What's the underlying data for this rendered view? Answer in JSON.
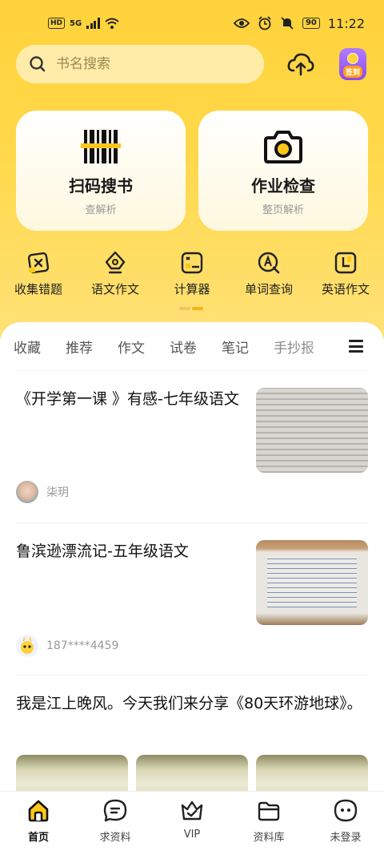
{
  "status_bar": {
    "network_badge": "HD",
    "network_type": "5G",
    "battery": "90",
    "time": "11:22"
  },
  "search": {
    "placeholder": "书名搜索"
  },
  "header_icons": {
    "upload": "upload-cloud-icon",
    "signin_label": "签到"
  },
  "big_cards": [
    {
      "title": "扫码搜书",
      "subtitle": "查解析",
      "icon": "barcode-scan-icon"
    },
    {
      "title": "作业检查",
      "subtitle": "整页解析",
      "icon": "camera-icon"
    }
  ],
  "tools": [
    {
      "label": "收集错题",
      "icon": "wrong-question-icon"
    },
    {
      "label": "语文作文",
      "icon": "pen-nib-icon"
    },
    {
      "label": "计算器",
      "icon": "calculator-icon"
    },
    {
      "label": "单词查询",
      "icon": "word-search-icon"
    },
    {
      "label": "英语作文",
      "icon": "english-essay-icon"
    }
  ],
  "tabs": [
    "收藏",
    "推荐",
    "作文",
    "试卷",
    "笔记",
    "手抄报"
  ],
  "articles": [
    {
      "title": "《开学第一课 》有感-七年级语文",
      "author": "柒玥"
    },
    {
      "title": "鲁滨逊漂流记-五年级语文",
      "author": "187****4459"
    },
    {
      "title": "我是江上晚风。今天我们来分享《80天环游地球》。"
    }
  ],
  "bottom_nav": [
    {
      "label": "首页",
      "icon": "home-icon",
      "active": true
    },
    {
      "label": "求资料",
      "icon": "message-icon"
    },
    {
      "label": "VIP",
      "icon": "crown-icon"
    },
    {
      "label": "资料库",
      "icon": "folder-icon"
    },
    {
      "label": "未登录",
      "icon": "user-face-icon"
    }
  ],
  "colors": {
    "accent": "#ffd23a",
    "accent_dark": "#f5b21a"
  }
}
